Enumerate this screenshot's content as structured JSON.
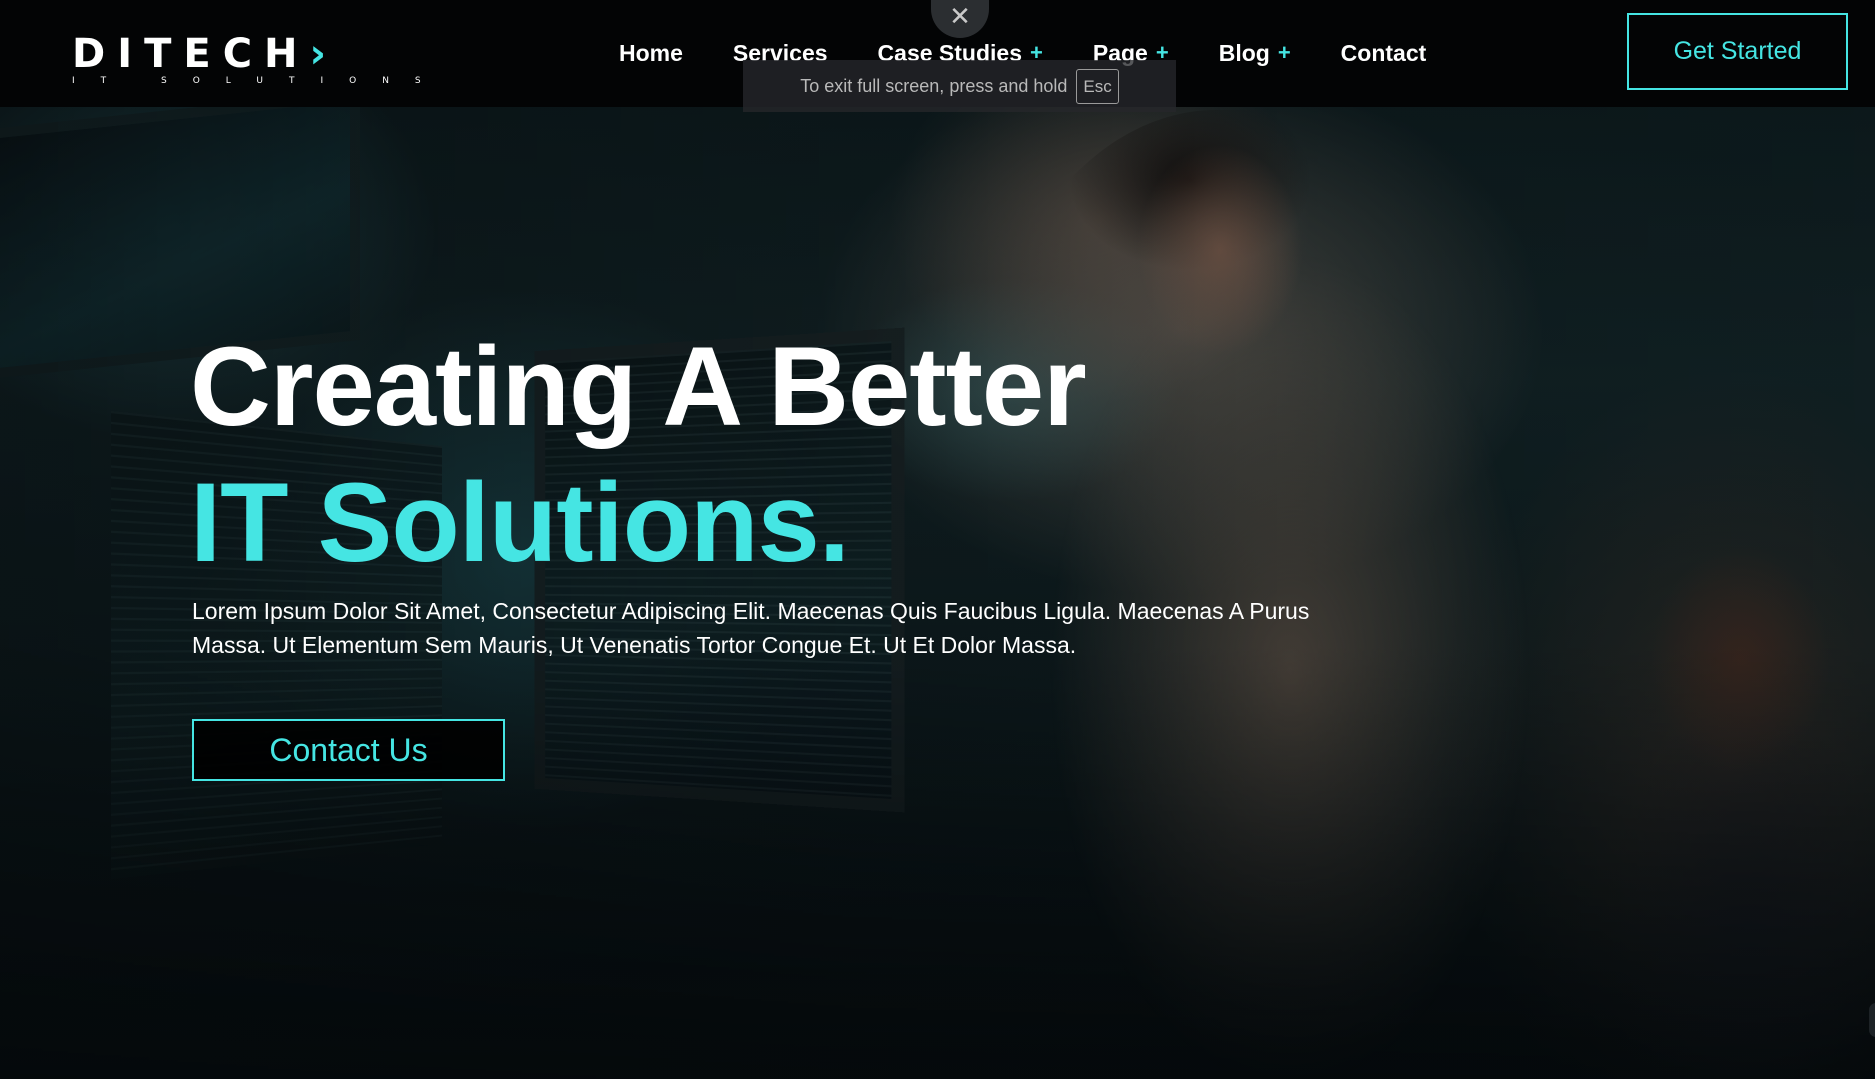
{
  "brand": {
    "logo_main": "DITECH",
    "logo_tagline": "IT SOLUTIONS",
    "accent_color": "#45e5e3"
  },
  "nav": {
    "items": [
      {
        "label": "Home",
        "has_submenu": false
      },
      {
        "label": "Services",
        "has_submenu": false
      },
      {
        "label": "Case Studies",
        "has_submenu": true
      },
      {
        "label": "Page",
        "has_submenu": true
      },
      {
        "label": "Blog",
        "has_submenu": true
      },
      {
        "label": "Contact",
        "has_submenu": false
      }
    ],
    "submenu_glyph": "+"
  },
  "header": {
    "cta_label": "Get Started"
  },
  "fullscreen_notice": {
    "close_glyph": "✕",
    "text": "To exit full screen, press and hold",
    "key": "Esc"
  },
  "hero": {
    "title_line1": "Creating A Better",
    "title_line2": "IT Solutions.",
    "description": "Lorem Ipsum Dolor Sit Amet, Consectetur Adipiscing Elit. Maecenas Quis Faucibus Ligula. Maecenas A Purus Massa. Ut Elementum Sem Mauris, Ut Venenatis Tortor Congue Et. Ut Et Dolor Massa.",
    "cta_label": "Contact Us"
  },
  "icons": {
    "close": "close-icon",
    "submenu": "plus-icon"
  }
}
